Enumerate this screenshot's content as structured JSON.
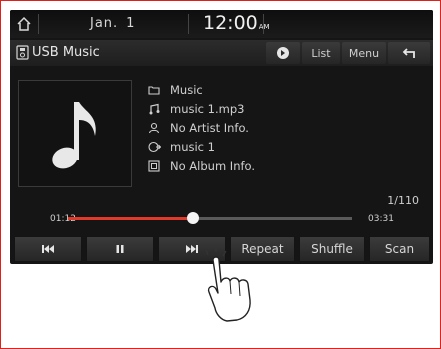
{
  "status": {
    "date_month": "Jan.",
    "date_day": "1",
    "time": "12:00",
    "ampm": "AM"
  },
  "source": {
    "label": "USB Music"
  },
  "titlebar": {
    "list_label": "List",
    "menu_label": "Menu"
  },
  "track": {
    "folder": "Music",
    "file": "music 1.mp3",
    "artist": "No Artist Info.",
    "title": "music 1",
    "album": "No Album Info.",
    "count": "1/110"
  },
  "progress": {
    "elapsed": "01:12",
    "total": "03:31",
    "fraction": 0.44
  },
  "controls": {
    "repeat": "Repeat",
    "shuffle": "Shuffle",
    "scan": "Scan"
  },
  "colors": {
    "accent": "#e03a2a",
    "frame": "#e0201b",
    "screen_bg": "#151515"
  }
}
